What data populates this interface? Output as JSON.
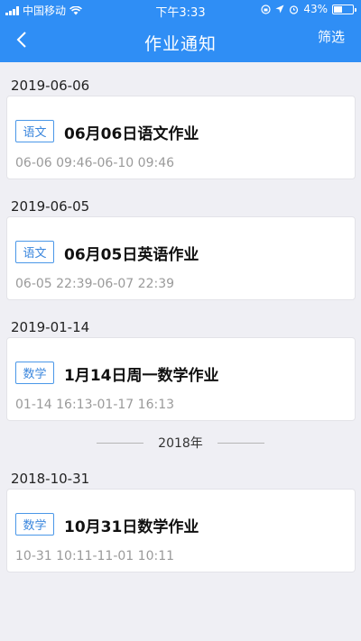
{
  "status": {
    "carrier": "中国移动",
    "time": "下午3:33",
    "battery": "43%",
    "battery_level": 0.43
  },
  "nav": {
    "title": "作业通知",
    "filter_label": "筛选"
  },
  "groups": [
    {
      "date": "2019-06-06",
      "item": {
        "subject": "语文",
        "title": "06月06日语文作业",
        "time": "06-06 09:46-06-10 09:46"
      }
    },
    {
      "date": "2019-06-05",
      "item": {
        "subject": "语文",
        "title": "06月05日英语作业",
        "time": "06-05 22:39-06-07 22:39"
      }
    },
    {
      "date": "2019-01-14",
      "item": {
        "subject": "数学",
        "title": "1月14日周一数学作业",
        "time": "01-14 16:13-01-17 16:13"
      }
    },
    {
      "date": "2018-10-31",
      "item": {
        "subject": "数学",
        "title": "10月31日数学作业",
        "time": "10-31 10:11-11-01 10:11"
      }
    }
  ],
  "year_divider": "2018年",
  "colors": {
    "header": "#2f8ef5",
    "tag_border": "#4a97e8",
    "background": "#efeff4"
  }
}
